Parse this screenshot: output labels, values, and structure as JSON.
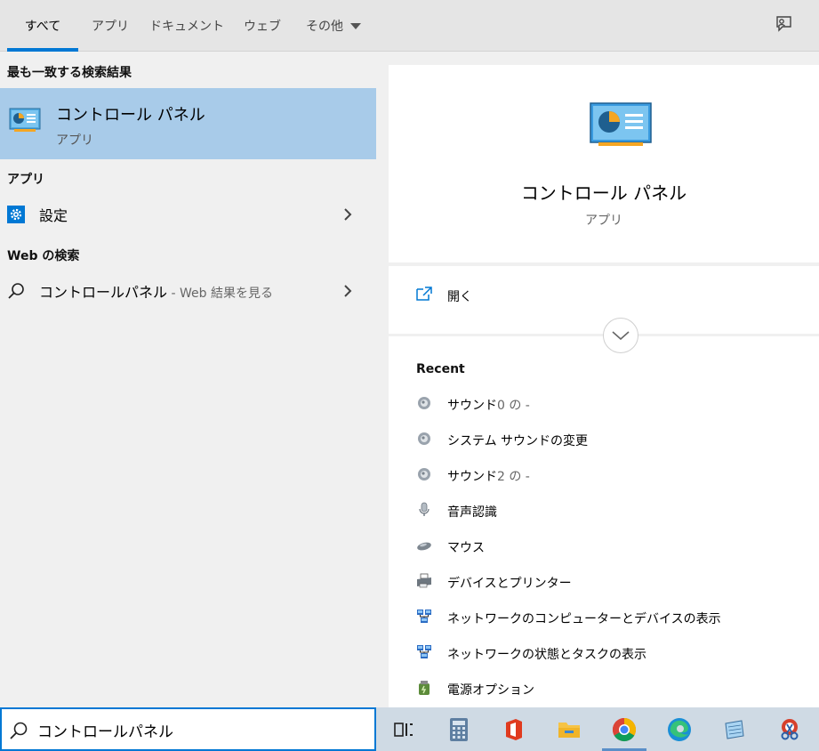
{
  "tabs": [
    {
      "label": "すべて",
      "active": true
    },
    {
      "label": "アプリ"
    },
    {
      "label": "ドキュメント"
    },
    {
      "label": "ウェブ"
    },
    {
      "label": "その他"
    }
  ],
  "left": {
    "best_match_title": "最も一致する検索結果",
    "best_match": {
      "name": "コントロール パネル",
      "type": "アプリ"
    },
    "apps_title": "アプリ",
    "apps": [
      {
        "name": "設定"
      }
    ],
    "web_title": "Web の検索",
    "web": {
      "query": "コントロールパネル",
      "hint": " - Web 結果を見る"
    }
  },
  "preview": {
    "name": "コントロール パネル",
    "type": "アプリ",
    "open_label": "開く",
    "recent_title": "Recent",
    "recent": [
      {
        "label": "サウンド",
        "suffix": "0 の -",
        "icon": "speaker-icon"
      },
      {
        "label": "システム サウンドの変更",
        "suffix": "",
        "icon": "speaker-icon"
      },
      {
        "label": "サウンド",
        "suffix": "2 の -",
        "icon": "speaker-icon"
      },
      {
        "label": "音声認識",
        "suffix": "",
        "icon": "microphone-icon"
      },
      {
        "label": "マウス",
        "suffix": "",
        "icon": "mouse-icon"
      },
      {
        "label": "デバイスとプリンター",
        "suffix": "",
        "icon": "printer-icon"
      },
      {
        "label": "ネットワークのコンピューターとデバイスの表示",
        "suffix": "",
        "icon": "network-icon"
      },
      {
        "label": "ネットワークの状態とタスクの表示",
        "suffix": "",
        "icon": "network-icon"
      },
      {
        "label": "電源オプション",
        "suffix": "",
        "icon": "power-options-icon"
      }
    ]
  },
  "search": {
    "value": "コントロールパネル"
  },
  "taskbar": [
    {
      "name": "task-view-icon"
    },
    {
      "name": "calculator-icon"
    },
    {
      "name": "office-icon"
    },
    {
      "name": "file-explorer-icon"
    },
    {
      "name": "chrome-icon",
      "active": true
    },
    {
      "name": "edge-icon"
    },
    {
      "name": "notepad-icon"
    },
    {
      "name": "snipping-tool-icon"
    }
  ],
  "colors": {
    "accent": "#0078d4",
    "selected_bg": "#a8cbe9",
    "taskbar_bg": "#cfdae4"
  }
}
